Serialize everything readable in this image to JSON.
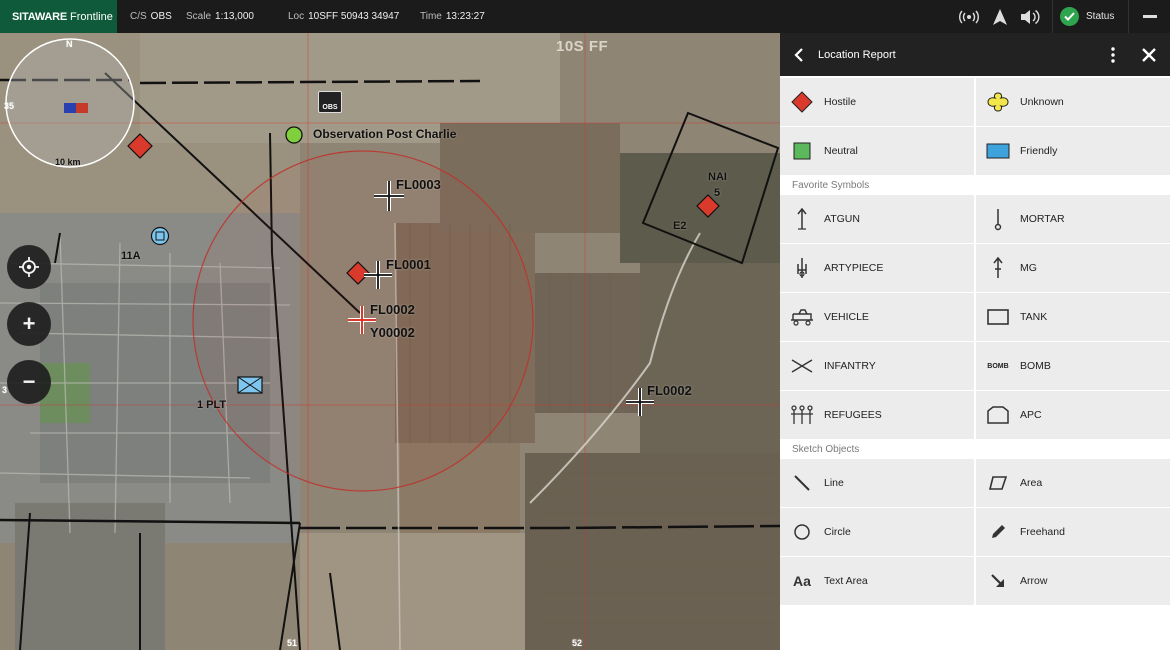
{
  "topbar": {
    "brand_bold": "SITAWARE",
    "brand_light": "Frontline",
    "cs_label": "C/S",
    "cs_value": "OBS",
    "scale_label": "Scale",
    "scale_value": "1:13,000",
    "loc_label": "Loc",
    "loc_value": "10SFF 50943 34947",
    "time_label": "Time",
    "time_value": "13:23:27",
    "status_label": "Status"
  },
  "map": {
    "grid_zone": "10S FF",
    "compass_north": "N",
    "compass_scale": "10 km",
    "obs_badge": "OBS",
    "observation_post": "Observation Post Charlie",
    "labels": {
      "fl0003": "FL0003",
      "fl0001": "FL0001",
      "fl0002a": "FL0002",
      "y00002": "Y00002",
      "fl0002b": "FL0002",
      "nai": "NAI",
      "nai_num": "5",
      "e2": "E2",
      "unit_11a": "11A",
      "platoon": "1 PLT",
      "edge_35": "35",
      "edge_3": "3",
      "edge_51": "51",
      "edge_52": "52"
    },
    "zoom_in": "+",
    "zoom_out": "−"
  },
  "panel": {
    "title": "Location Report",
    "affiliation": [
      {
        "label": "Hostile",
        "icon": "hostile-diamond-icon",
        "color": "#d93a2b"
      },
      {
        "label": "Unknown",
        "icon": "unknown-clover-icon",
        "color": "#f2e64a"
      },
      {
        "label": "Neutral",
        "icon": "neutral-square-icon",
        "color": "#5cb85c"
      },
      {
        "label": "Friendly",
        "icon": "friendly-rectangle-icon",
        "color": "#3ea3dc"
      }
    ],
    "favorites_title": "Favorite Symbols",
    "favorites": [
      {
        "label": "ATGUN",
        "icon": "atgun-icon"
      },
      {
        "label": "MORTAR",
        "icon": "mortar-icon"
      },
      {
        "label": "ARTYPIECE",
        "icon": "artypiece-icon"
      },
      {
        "label": "MG",
        "icon": "mg-icon"
      },
      {
        "label": "VEHICLE",
        "icon": "vehicle-icon"
      },
      {
        "label": "TANK",
        "icon": "tank-icon"
      },
      {
        "label": "INFANTRY",
        "icon": "infantry-icon"
      },
      {
        "label": "BOMB",
        "icon": "bomb-icon",
        "icon_text": "BOMB"
      },
      {
        "label": "REFUGEES",
        "icon": "refugees-icon"
      },
      {
        "label": "APC",
        "icon": "apc-icon"
      }
    ],
    "sketch_title": "Sketch Objects",
    "sketch": [
      {
        "label": "Line",
        "icon": "line-icon"
      },
      {
        "label": "Area",
        "icon": "area-icon"
      },
      {
        "label": "Circle",
        "icon": "circle-icon"
      },
      {
        "label": "Freehand",
        "icon": "freehand-icon"
      },
      {
        "label": "Text Area",
        "icon": "text-area-icon",
        "icon_text": "Aa"
      },
      {
        "label": "Arrow",
        "icon": "arrow-icon"
      }
    ]
  }
}
